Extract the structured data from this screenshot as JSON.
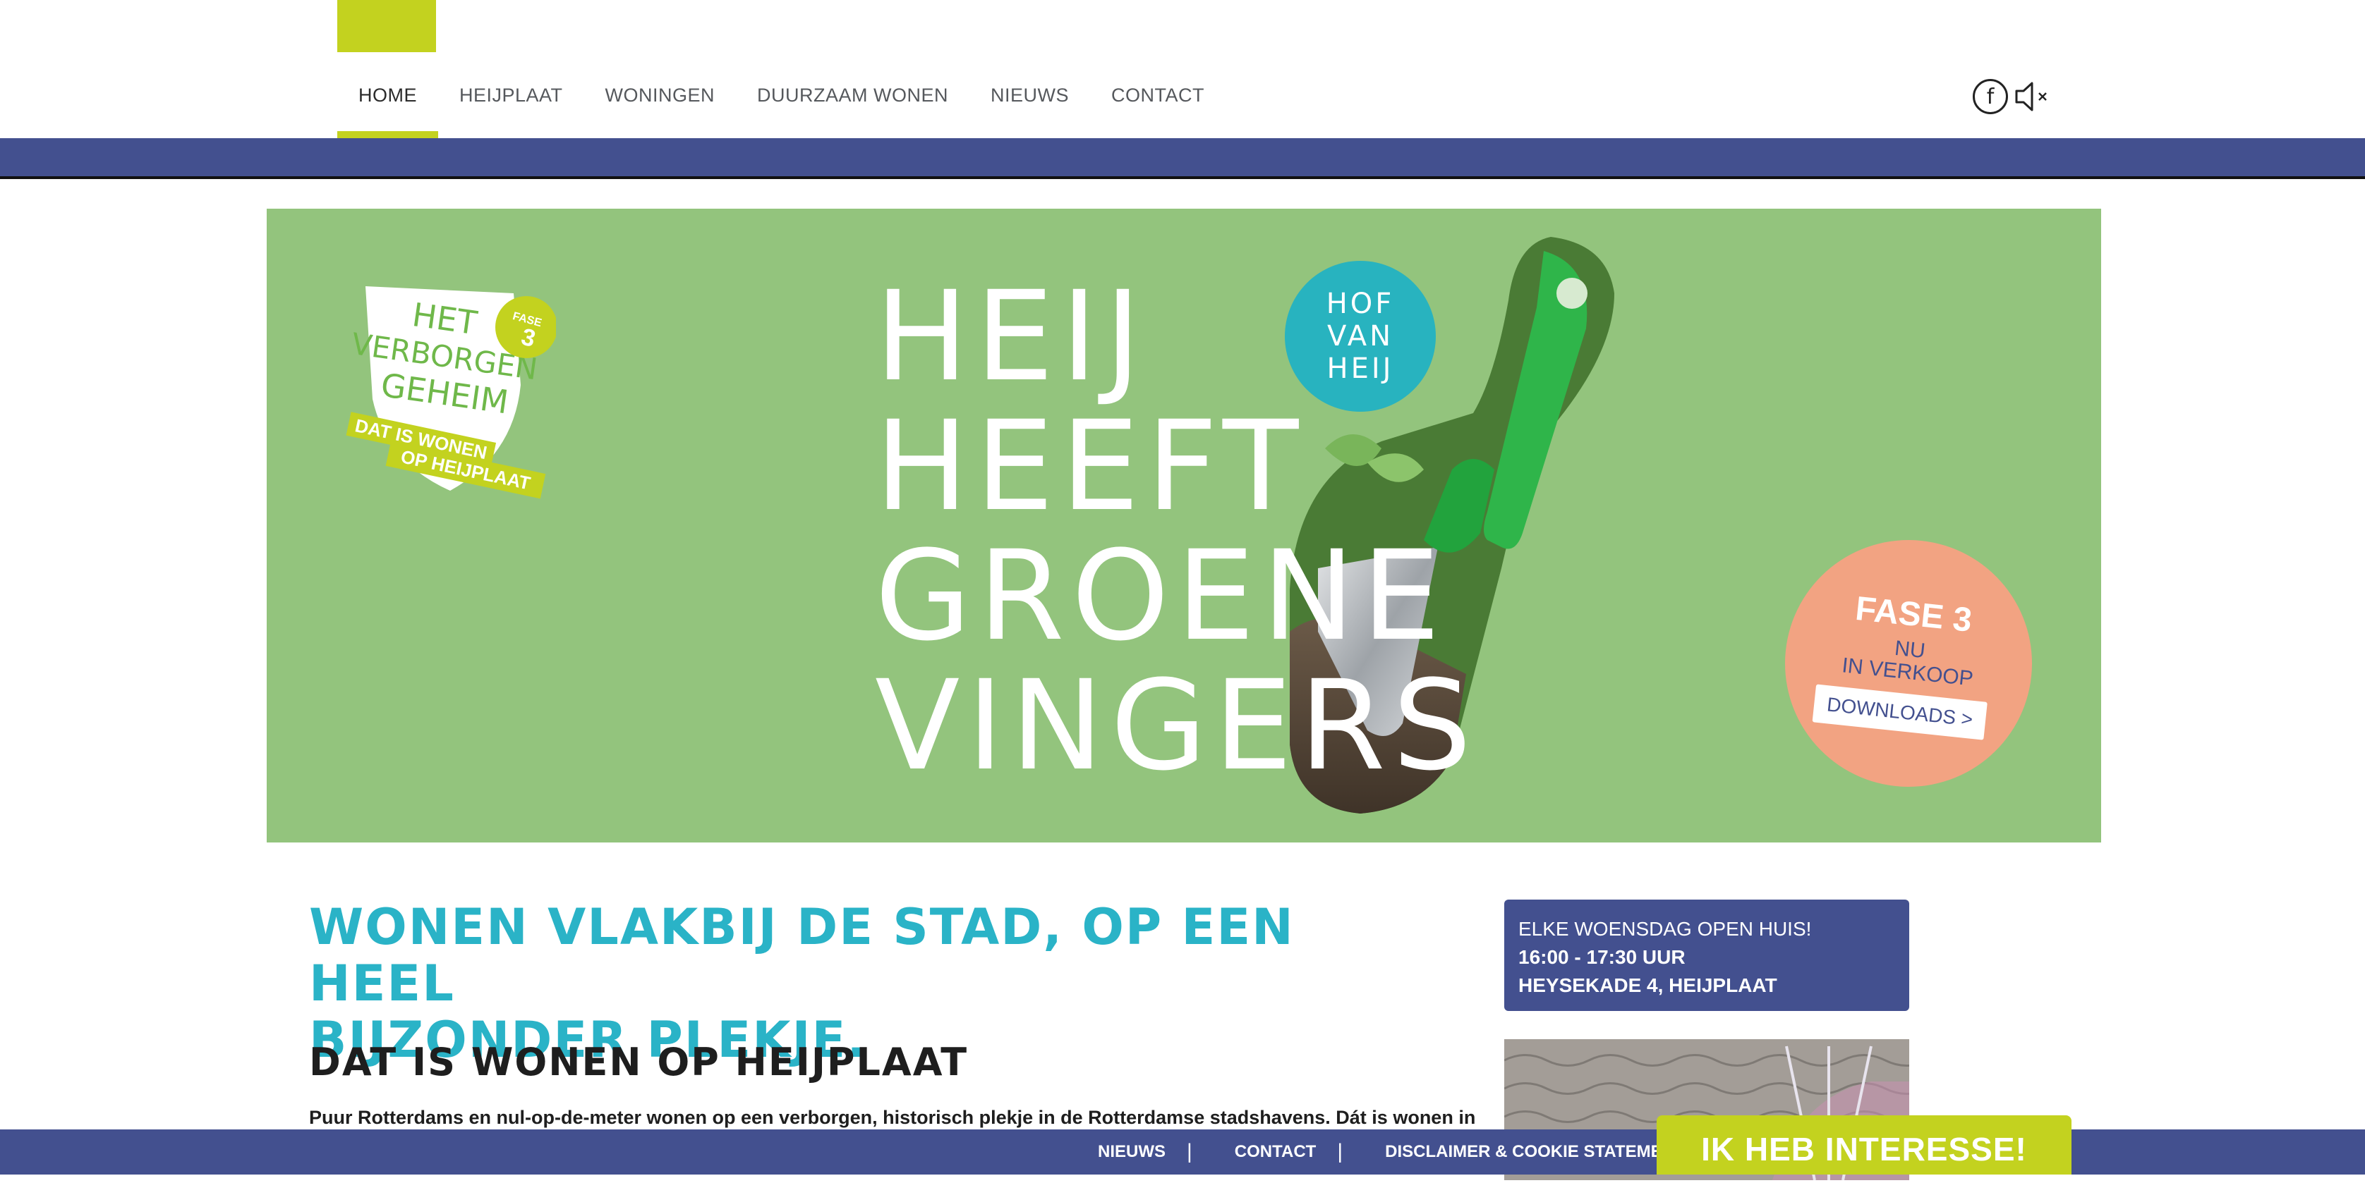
{
  "nav": {
    "items": [
      {
        "label": "HOME",
        "active": true
      },
      {
        "label": "HEIJPLAAT"
      },
      {
        "label": "WONINGEN"
      },
      {
        "label": "DUURZAAM WONEN"
      },
      {
        "label": "NIEUWS"
      },
      {
        "label": "CONTACT"
      }
    ],
    "social": {
      "facebook_icon": "f",
      "mute_icon": "speaker-muted-icon"
    }
  },
  "hero": {
    "badge": {
      "title_lines": [
        "HET",
        "VERBORGEN",
        "GEHEIM"
      ],
      "tag_lines": [
        "DAT IS WONEN",
        "OP HEIJPLAAT"
      ],
      "fase_label": "FASE",
      "fase_number": "3"
    },
    "headline_lines": [
      "HEIJ",
      "HEEFT",
      "GROENE",
      "VINGERS"
    ],
    "hof_lines": [
      "HOF",
      "VAN",
      "HEIJ"
    ],
    "fase_circle": {
      "title": "FASE 3",
      "sub_line1": "NU",
      "sub_line2": "IN VERKOOP",
      "button": "DOWNLOADS >"
    }
  },
  "content": {
    "title_line1": "WONEN VLAKBIJ DE STAD, OP EEN HEEL",
    "title_line2": "BIJZONDER PLEKJE.",
    "subtitle": "DAT IS WONEN OP HEIJPLAAT",
    "body": "Puur Rotterdams en nul-op-de-meter wonen op een verborgen, historisch plekje in de Rotterdamse stadshavens. Dát is wonen in"
  },
  "sidebar": {
    "openhuis_line1": "ELKE WOENSDAG OPEN HUIS!",
    "openhuis_line2": "16:00 - 17:30 UUR",
    "openhuis_line3": "HEYSEKADE 4, HEIJPLAAT"
  },
  "footer": {
    "links": [
      "NIEUWS",
      "CONTACT",
      "DISCLAIMER & COOKIE STATEMENT"
    ],
    "separator": "|",
    "cta": "IK HEB INTERESSE!"
  },
  "colors": {
    "accent_lime": "#c3d21f",
    "brand_blue": "#43508f",
    "hero_green": "#93c47d",
    "title_teal": "#2ab3c7",
    "fase_salmon": "#f2a382",
    "hof_teal": "#28b3bf"
  }
}
